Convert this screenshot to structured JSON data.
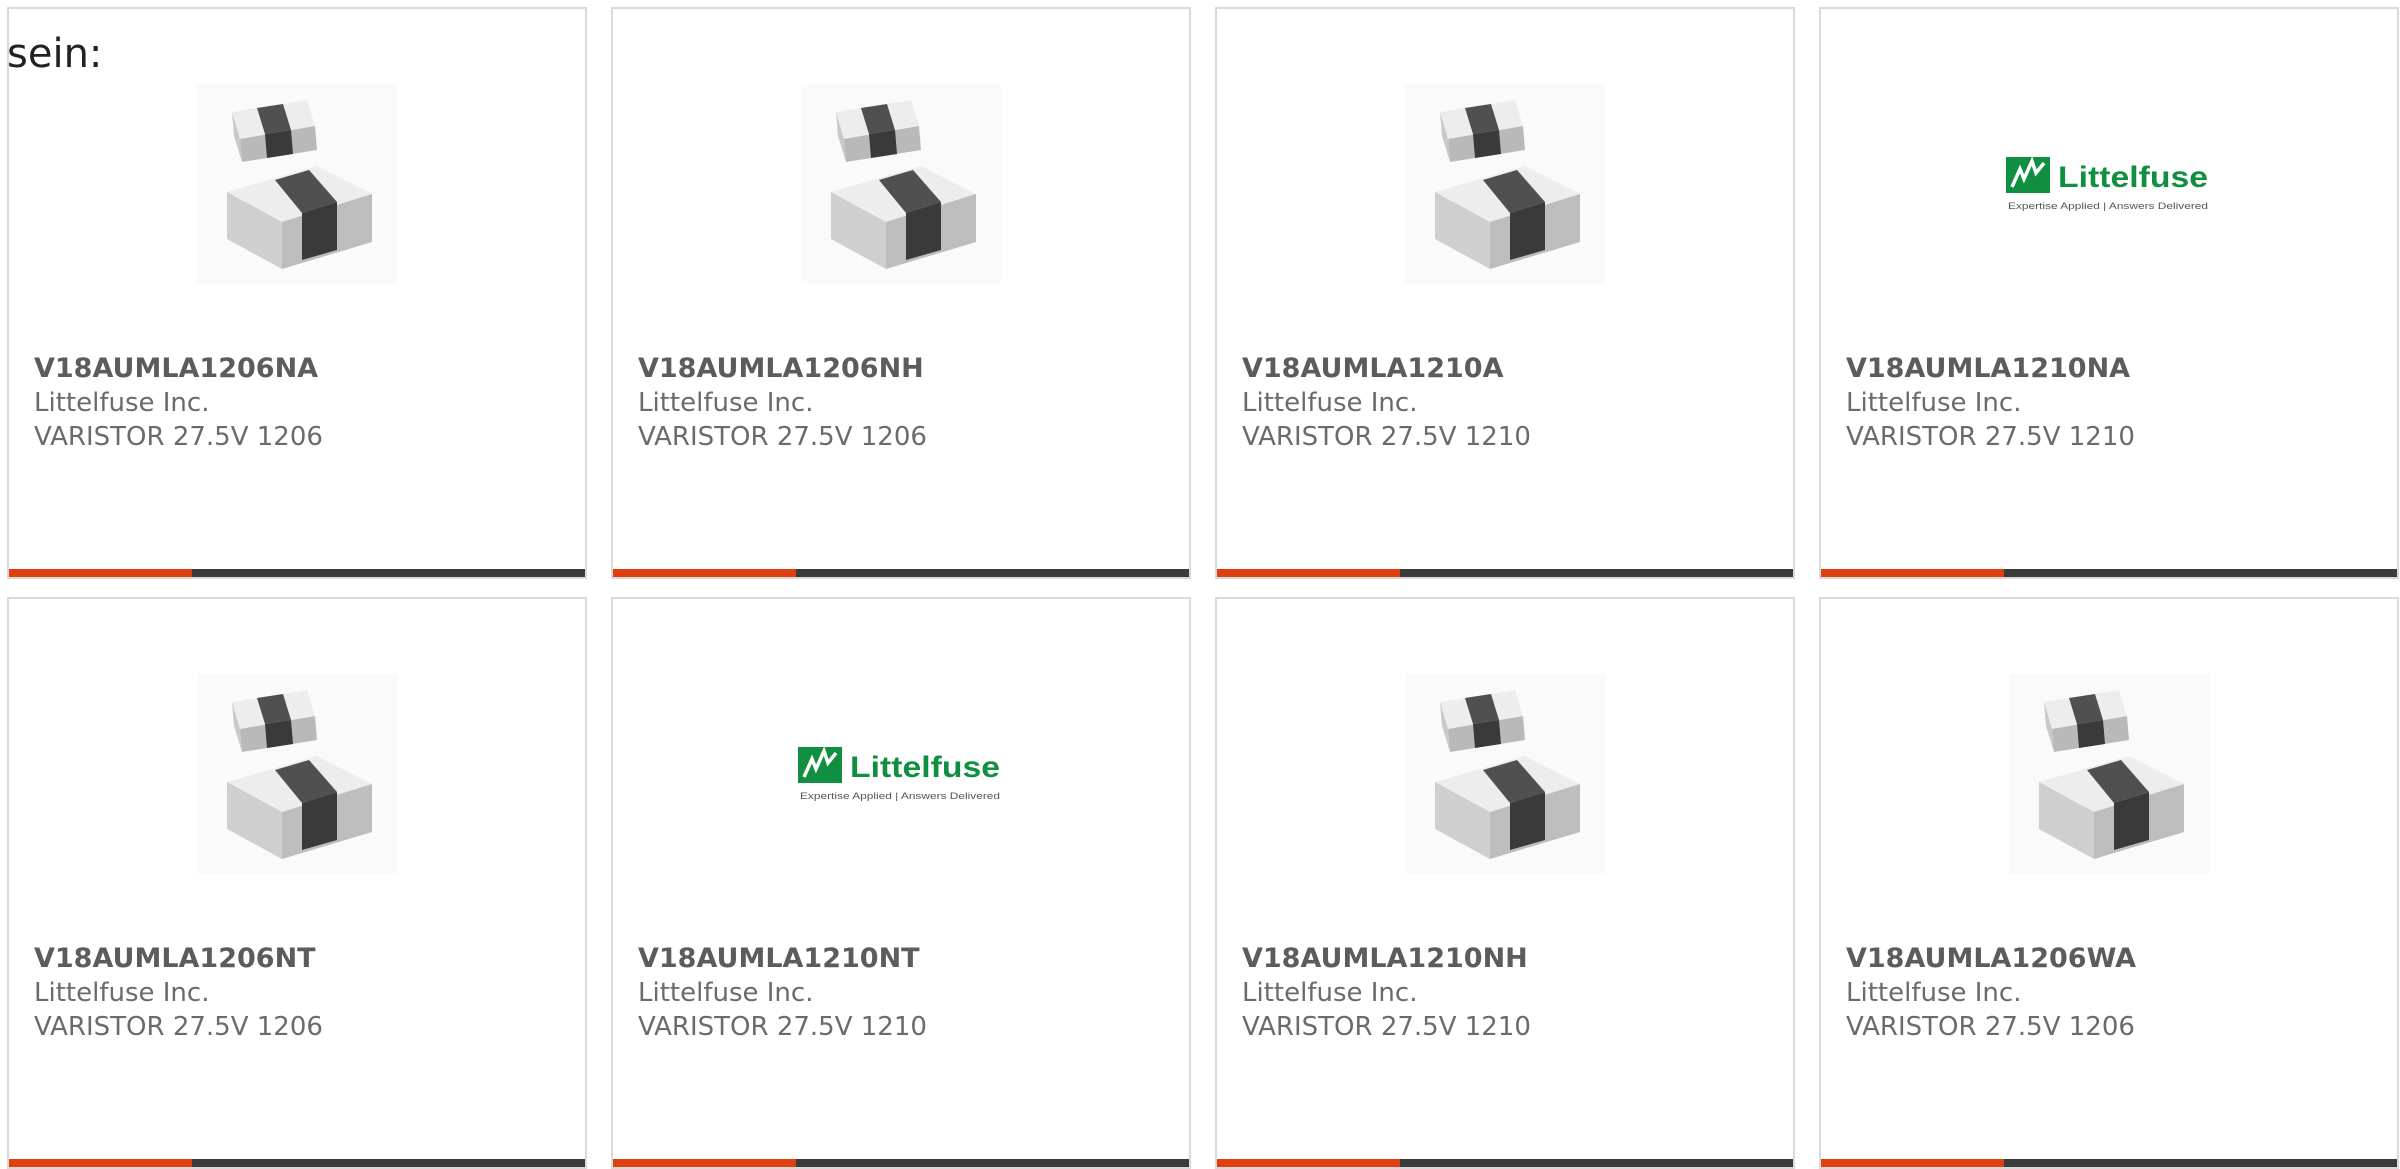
{
  "intro_text": "sein:",
  "colors": {
    "accent": "#e0400f",
    "bar_dark": "#3b3b3b",
    "logo_green": "#0f8f3f"
  },
  "logo": {
    "brand": "Littelfuse",
    "tagline": "Expertise Applied | Answers Delivered"
  },
  "products": [
    {
      "part_number": "V18AUMLA1206NA",
      "manufacturer": "Littelfuse Inc.",
      "description": "VARISTOR 27.5V 1206",
      "image": "smd-chip-varistor-icon"
    },
    {
      "part_number": "V18AUMLA1206NH",
      "manufacturer": "Littelfuse Inc.",
      "description": "VARISTOR 27.5V 1206",
      "image": "smd-chip-varistor-icon"
    },
    {
      "part_number": "V18AUMLA1210A",
      "manufacturer": "Littelfuse Inc.",
      "description": "VARISTOR 27.5V 1210",
      "image": "smd-chip-varistor-icon"
    },
    {
      "part_number": "V18AUMLA1210NA",
      "manufacturer": "Littelfuse Inc.",
      "description": "VARISTOR 27.5V 1210",
      "image": "littelfuse-logo"
    },
    {
      "part_number": "V18AUMLA1206NT",
      "manufacturer": "Littelfuse Inc.",
      "description": "VARISTOR 27.5V 1206",
      "image": "smd-chip-varistor-icon"
    },
    {
      "part_number": "V18AUMLA1210NT",
      "manufacturer": "Littelfuse Inc.",
      "description": "VARISTOR 27.5V 1210",
      "image": "littelfuse-logo"
    },
    {
      "part_number": "V18AUMLA1210NH",
      "manufacturer": "Littelfuse Inc.",
      "description": "VARISTOR 27.5V 1210",
      "image": "smd-chip-varistor-icon"
    },
    {
      "part_number": "V18AUMLA1206WA",
      "manufacturer": "Littelfuse Inc.",
      "description": "VARISTOR 27.5V 1206",
      "image": "smd-chip-varistor-icon"
    }
  ]
}
